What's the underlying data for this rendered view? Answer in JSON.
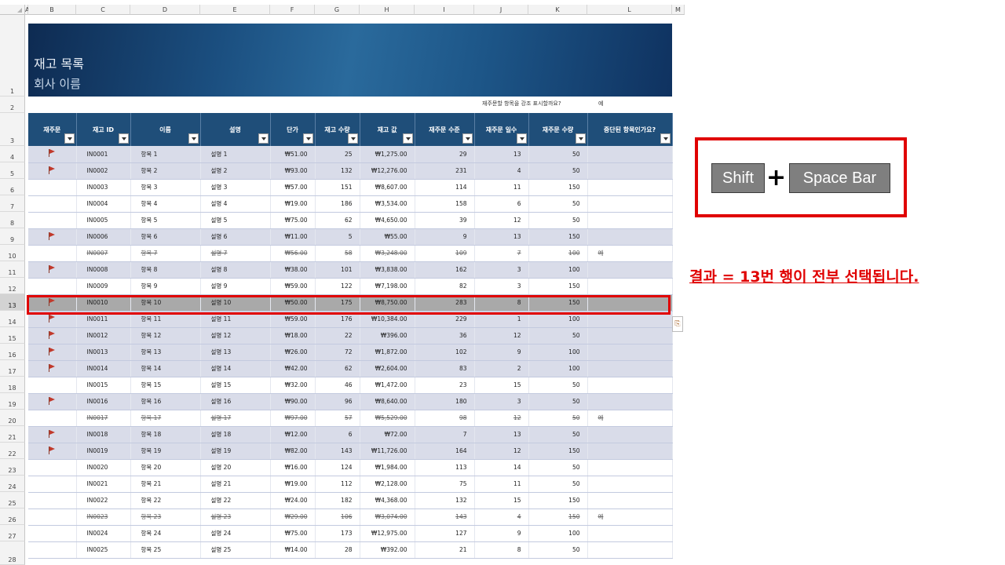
{
  "sheet": {
    "columns": [
      "A",
      "B",
      "C",
      "D",
      "E",
      "F",
      "G",
      "H",
      "I",
      "J",
      "K",
      "L",
      "M"
    ],
    "rownums": [
      "1",
      "2",
      "3",
      "4",
      "5",
      "6",
      "7",
      "8",
      "9",
      "10",
      "11",
      "12",
      "13",
      "14",
      "15",
      "16",
      "17",
      "18",
      "19",
      "20",
      "21",
      "22",
      "23",
      "24",
      "25",
      "26",
      "27",
      "28"
    ],
    "selected_row": "13"
  },
  "banner": {
    "title": "재고 목록",
    "subtitle": "회사 이름"
  },
  "highlight": {
    "question": "재주문할 항목을 강조 표시할까요?",
    "answer": "예"
  },
  "table": {
    "headers": [
      "재주문",
      "재고 ID",
      "이름",
      "설명",
      "단가",
      "재고 수량",
      "재고 값",
      "재주문 수준",
      "재주문 일수",
      "재주문 수량",
      "중단된 항목인가요?"
    ],
    "rows": [
      {
        "flag": true,
        "id": "IN0001",
        "name": "항목 1",
        "desc": "설명 1",
        "price": "₩51.00",
        "qty": "25",
        "value": "₩1,275.00",
        "level": "29",
        "days": "13",
        "rqty": "50",
        "disc": "",
        "style": "alt"
      },
      {
        "flag": true,
        "id": "IN0002",
        "name": "항목 2",
        "desc": "설명 2",
        "price": "₩93.00",
        "qty": "132",
        "value": "₩12,276.00",
        "level": "231",
        "days": "4",
        "rqty": "50",
        "disc": "",
        "style": "alt"
      },
      {
        "flag": false,
        "id": "IN0003",
        "name": "항목 3",
        "desc": "설명 3",
        "price": "₩57.00",
        "qty": "151",
        "value": "₩8,607.00",
        "level": "114",
        "days": "11",
        "rqty": "150",
        "disc": "",
        "style": ""
      },
      {
        "flag": false,
        "id": "IN0004",
        "name": "항목 4",
        "desc": "설명 4",
        "price": "₩19.00",
        "qty": "186",
        "value": "₩3,534.00",
        "level": "158",
        "days": "6",
        "rqty": "50",
        "disc": "",
        "style": ""
      },
      {
        "flag": false,
        "id": "IN0005",
        "name": "항목 5",
        "desc": "설명 5",
        "price": "₩75.00",
        "qty": "62",
        "value": "₩4,650.00",
        "level": "39",
        "days": "12",
        "rqty": "50",
        "disc": "",
        "style": ""
      },
      {
        "flag": true,
        "id": "IN0006",
        "name": "항목 6",
        "desc": "설명 6",
        "price": "₩11.00",
        "qty": "5",
        "value": "₩55.00",
        "level": "9",
        "days": "13",
        "rqty": "150",
        "disc": "",
        "style": "alt"
      },
      {
        "flag": false,
        "id": "IN0007",
        "name": "항목 7",
        "desc": "설명 7",
        "price": "₩56.00",
        "qty": "58",
        "value": "₩3,248.00",
        "level": "109",
        "days": "7",
        "rqty": "100",
        "disc": "예",
        "style": "strike"
      },
      {
        "flag": true,
        "id": "IN0008",
        "name": "항목 8",
        "desc": "설명 8",
        "price": "₩38.00",
        "qty": "101",
        "value": "₩3,838.00",
        "level": "162",
        "days": "3",
        "rqty": "100",
        "disc": "",
        "style": "alt"
      },
      {
        "flag": false,
        "id": "IN0009",
        "name": "항목 9",
        "desc": "설명 9",
        "price": "₩59.00",
        "qty": "122",
        "value": "₩7,198.00",
        "level": "82",
        "days": "3",
        "rqty": "150",
        "disc": "",
        "style": ""
      },
      {
        "flag": true,
        "id": "IN0010",
        "name": "항목 10",
        "desc": "설명 10",
        "price": "₩50.00",
        "qty": "175",
        "value": "₩8,750.00",
        "level": "283",
        "days": "8",
        "rqty": "150",
        "disc": "",
        "style": "sel"
      },
      {
        "flag": true,
        "id": "IN0011",
        "name": "항목 11",
        "desc": "설명 11",
        "price": "₩59.00",
        "qty": "176",
        "value": "₩10,384.00",
        "level": "229",
        "days": "1",
        "rqty": "100",
        "disc": "",
        "style": "alt"
      },
      {
        "flag": true,
        "id": "IN0012",
        "name": "항목 12",
        "desc": "설명 12",
        "price": "₩18.00",
        "qty": "22",
        "value": "₩396.00",
        "level": "36",
        "days": "12",
        "rqty": "50",
        "disc": "",
        "style": "alt"
      },
      {
        "flag": true,
        "id": "IN0013",
        "name": "항목 13",
        "desc": "설명 13",
        "price": "₩26.00",
        "qty": "72",
        "value": "₩1,872.00",
        "level": "102",
        "days": "9",
        "rqty": "100",
        "disc": "",
        "style": "alt"
      },
      {
        "flag": true,
        "id": "IN0014",
        "name": "항목 14",
        "desc": "설명 14",
        "price": "₩42.00",
        "qty": "62",
        "value": "₩2,604.00",
        "level": "83",
        "days": "2",
        "rqty": "100",
        "disc": "",
        "style": "alt"
      },
      {
        "flag": false,
        "id": "IN0015",
        "name": "항목 15",
        "desc": "설명 15",
        "price": "₩32.00",
        "qty": "46",
        "value": "₩1,472.00",
        "level": "23",
        "days": "15",
        "rqty": "50",
        "disc": "",
        "style": ""
      },
      {
        "flag": true,
        "id": "IN0016",
        "name": "항목 16",
        "desc": "설명 16",
        "price": "₩90.00",
        "qty": "96",
        "value": "₩8,640.00",
        "level": "180",
        "days": "3",
        "rqty": "50",
        "disc": "",
        "style": "alt"
      },
      {
        "flag": false,
        "id": "IN0017",
        "name": "항목 17",
        "desc": "설명 17",
        "price": "₩97.00",
        "qty": "57",
        "value": "₩5,529.00",
        "level": "98",
        "days": "12",
        "rqty": "50",
        "disc": "예",
        "style": "strike"
      },
      {
        "flag": true,
        "id": "IN0018",
        "name": "항목 18",
        "desc": "설명 18",
        "price": "₩12.00",
        "qty": "6",
        "value": "₩72.00",
        "level": "7",
        "days": "13",
        "rqty": "50",
        "disc": "",
        "style": "alt"
      },
      {
        "flag": true,
        "id": "IN0019",
        "name": "항목 19",
        "desc": "설명 19",
        "price": "₩82.00",
        "qty": "143",
        "value": "₩11,726.00",
        "level": "164",
        "days": "12",
        "rqty": "150",
        "disc": "",
        "style": "alt"
      },
      {
        "flag": false,
        "id": "IN0020",
        "name": "항목 20",
        "desc": "설명 20",
        "price": "₩16.00",
        "qty": "124",
        "value": "₩1,984.00",
        "level": "113",
        "days": "14",
        "rqty": "50",
        "disc": "",
        "style": ""
      },
      {
        "flag": false,
        "id": "IN0021",
        "name": "항목 21",
        "desc": "설명 21",
        "price": "₩19.00",
        "qty": "112",
        "value": "₩2,128.00",
        "level": "75",
        "days": "11",
        "rqty": "50",
        "disc": "",
        "style": ""
      },
      {
        "flag": false,
        "id": "IN0022",
        "name": "항목 22",
        "desc": "설명 22",
        "price": "₩24.00",
        "qty": "182",
        "value": "₩4,368.00",
        "level": "132",
        "days": "15",
        "rqty": "150",
        "disc": "",
        "style": ""
      },
      {
        "flag": false,
        "id": "IN0023",
        "name": "항목 23",
        "desc": "설명 23",
        "price": "₩29.00",
        "qty": "106",
        "value": "₩3,074.00",
        "level": "143",
        "days": "4",
        "rqty": "150",
        "disc": "예",
        "style": "strike"
      },
      {
        "flag": false,
        "id": "IN0024",
        "name": "항목 24",
        "desc": "설명 24",
        "price": "₩75.00",
        "qty": "173",
        "value": "₩12,975.00",
        "level": "127",
        "days": "9",
        "rqty": "100",
        "disc": "",
        "style": ""
      },
      {
        "flag": false,
        "id": "IN0025",
        "name": "항목 25",
        "desc": "설명 25",
        "price": "₩14.00",
        "qty": "28",
        "value": "₩392.00",
        "level": "21",
        "days": "8",
        "rqty": "50",
        "disc": "",
        "style": ""
      }
    ]
  },
  "shortcut": {
    "key1": "Shift",
    "plus": "+",
    "key2": "Space Bar"
  },
  "result": "결과 = 13번 행이 전부 선택됩니다.",
  "icons": {
    "flag": "flag-icon",
    "dropdown": "filter-dropdown-icon",
    "paste": "paste-options-icon"
  },
  "colors": {
    "header_blue": "#1f4e79",
    "alt_row": "#d9dce9",
    "selected_row": "#a9a9a9",
    "annotation_red": "#e00000"
  }
}
